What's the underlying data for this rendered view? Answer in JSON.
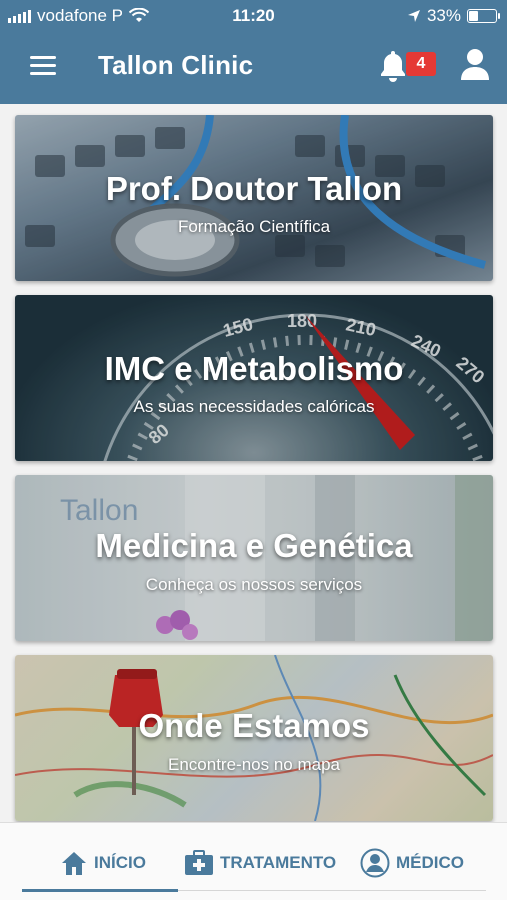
{
  "status_bar": {
    "carrier": "vodafone P",
    "time": "11:20",
    "battery": "33%",
    "battery_level": 0.33
  },
  "header": {
    "title": "Tallon Clinic",
    "notification_count": "4",
    "icons": [
      "menu-icon",
      "bell-icon",
      "user-icon"
    ]
  },
  "cards": [
    {
      "title": "Prof. Doutor Tallon",
      "subtitle": "Formação Científica"
    },
    {
      "title": "IMC e Metabolismo",
      "subtitle": "As suas necessidades calóricas"
    },
    {
      "title": "Medicina e Genética",
      "subtitle": "Conheça os nossos serviços"
    },
    {
      "title": "Onde Estamos",
      "subtitle": "Encontre-nos no mapa"
    }
  ],
  "tabs": [
    {
      "label": "INÍCIO",
      "icon": "home-icon",
      "active": true
    },
    {
      "label": "TRATAMENTO",
      "icon": "medical-kit-icon",
      "active": false
    },
    {
      "label": "MÉDICO",
      "icon": "doctor-avatar-icon",
      "active": false
    }
  ],
  "colors": {
    "primary": "#4a7a9c",
    "badge": "#e53935"
  }
}
